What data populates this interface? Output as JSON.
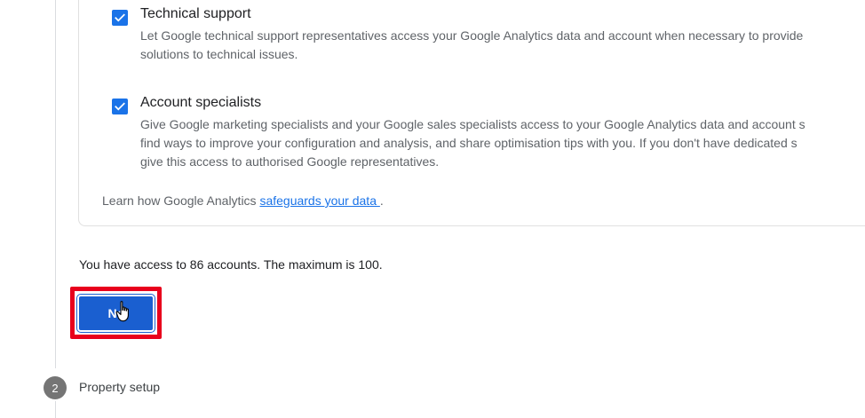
{
  "data_sharing": {
    "options": [
      {
        "title": "Technical support",
        "checked": true,
        "description_lines": [
          "Let Google technical support representatives access your Google Analytics data and account when necessary to provide",
          "solutions to technical issues."
        ]
      },
      {
        "title": "Account specialists",
        "checked": true,
        "description_lines": [
          "Give Google marketing specialists and your Google sales specialists access to your Google Analytics data and account s",
          "find ways to improve your configuration and analysis, and share optimisation tips with you. If you don't have dedicated s",
          "give this access to authorised Google representatives."
        ]
      }
    ],
    "learn_prefix": "Learn how Google Analytics ",
    "learn_link": "safeguards your data ",
    "learn_suffix": "."
  },
  "access_text": "You have access to 86 accounts. The maximum is 100.",
  "next_button_label": "Ne",
  "next_step": {
    "number": "2",
    "label": "Property setup"
  },
  "colors": {
    "accent": "#1a73e8",
    "highlight_border": "#e8001c",
    "step_circle": "#757575"
  },
  "icons": {
    "checkbox": "check-icon",
    "cursor": "hand-pointer-icon"
  }
}
